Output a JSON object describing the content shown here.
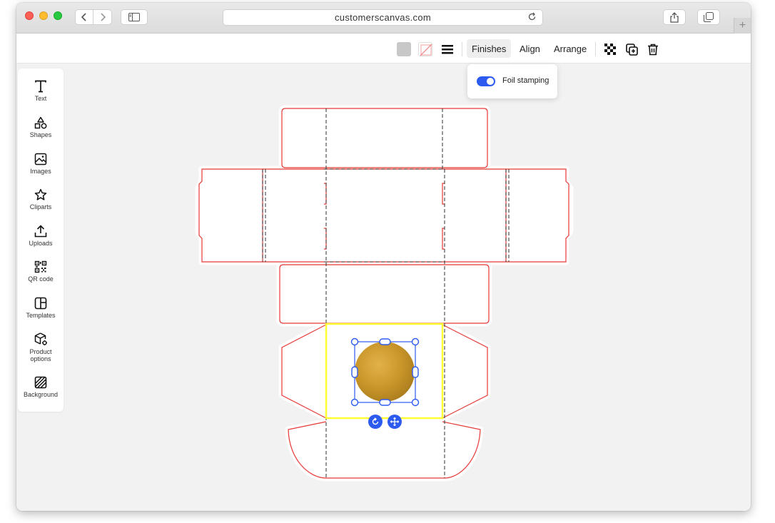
{
  "browser": {
    "url": "customerscanvas.com"
  },
  "toolbar": {
    "fill_color": "#c8c8c8",
    "items": {
      "finishes": "Finishes",
      "align": "Align",
      "arrange": "Arrange"
    },
    "icons": [
      "fill-swatch-icon",
      "stroke-swatch-icon",
      "line-weight-icon",
      "transparency-icon",
      "duplicate-icon",
      "delete-icon"
    ]
  },
  "finishes_popup": {
    "toggle_label": "Foil stamping",
    "toggle_on": true
  },
  "sidebar": {
    "items": [
      {
        "label": "Text",
        "icon": "text-icon"
      },
      {
        "label": "Shapes",
        "icon": "shapes-icon"
      },
      {
        "label": "Images",
        "icon": "image-icon"
      },
      {
        "label": "Cliparts",
        "icon": "star-icon"
      },
      {
        "label": "Uploads",
        "icon": "upload-icon"
      },
      {
        "label": "QR code",
        "icon": "qr-code-icon"
      },
      {
        "label": "Templates",
        "icon": "templates-icon"
      },
      {
        "label": "Product",
        "label2": "options",
        "icon": "product-options-icon"
      },
      {
        "label": "Background",
        "icon": "background-icon"
      }
    ]
  },
  "canvas": {
    "dieline_color": "#e53935",
    "fold_color": "#444444",
    "safe_zone_color": "#ffff33",
    "selection_color": "#2d5bf0",
    "foil_color": "#c9962a",
    "controls": [
      "rotate-icon",
      "move-icon"
    ]
  }
}
